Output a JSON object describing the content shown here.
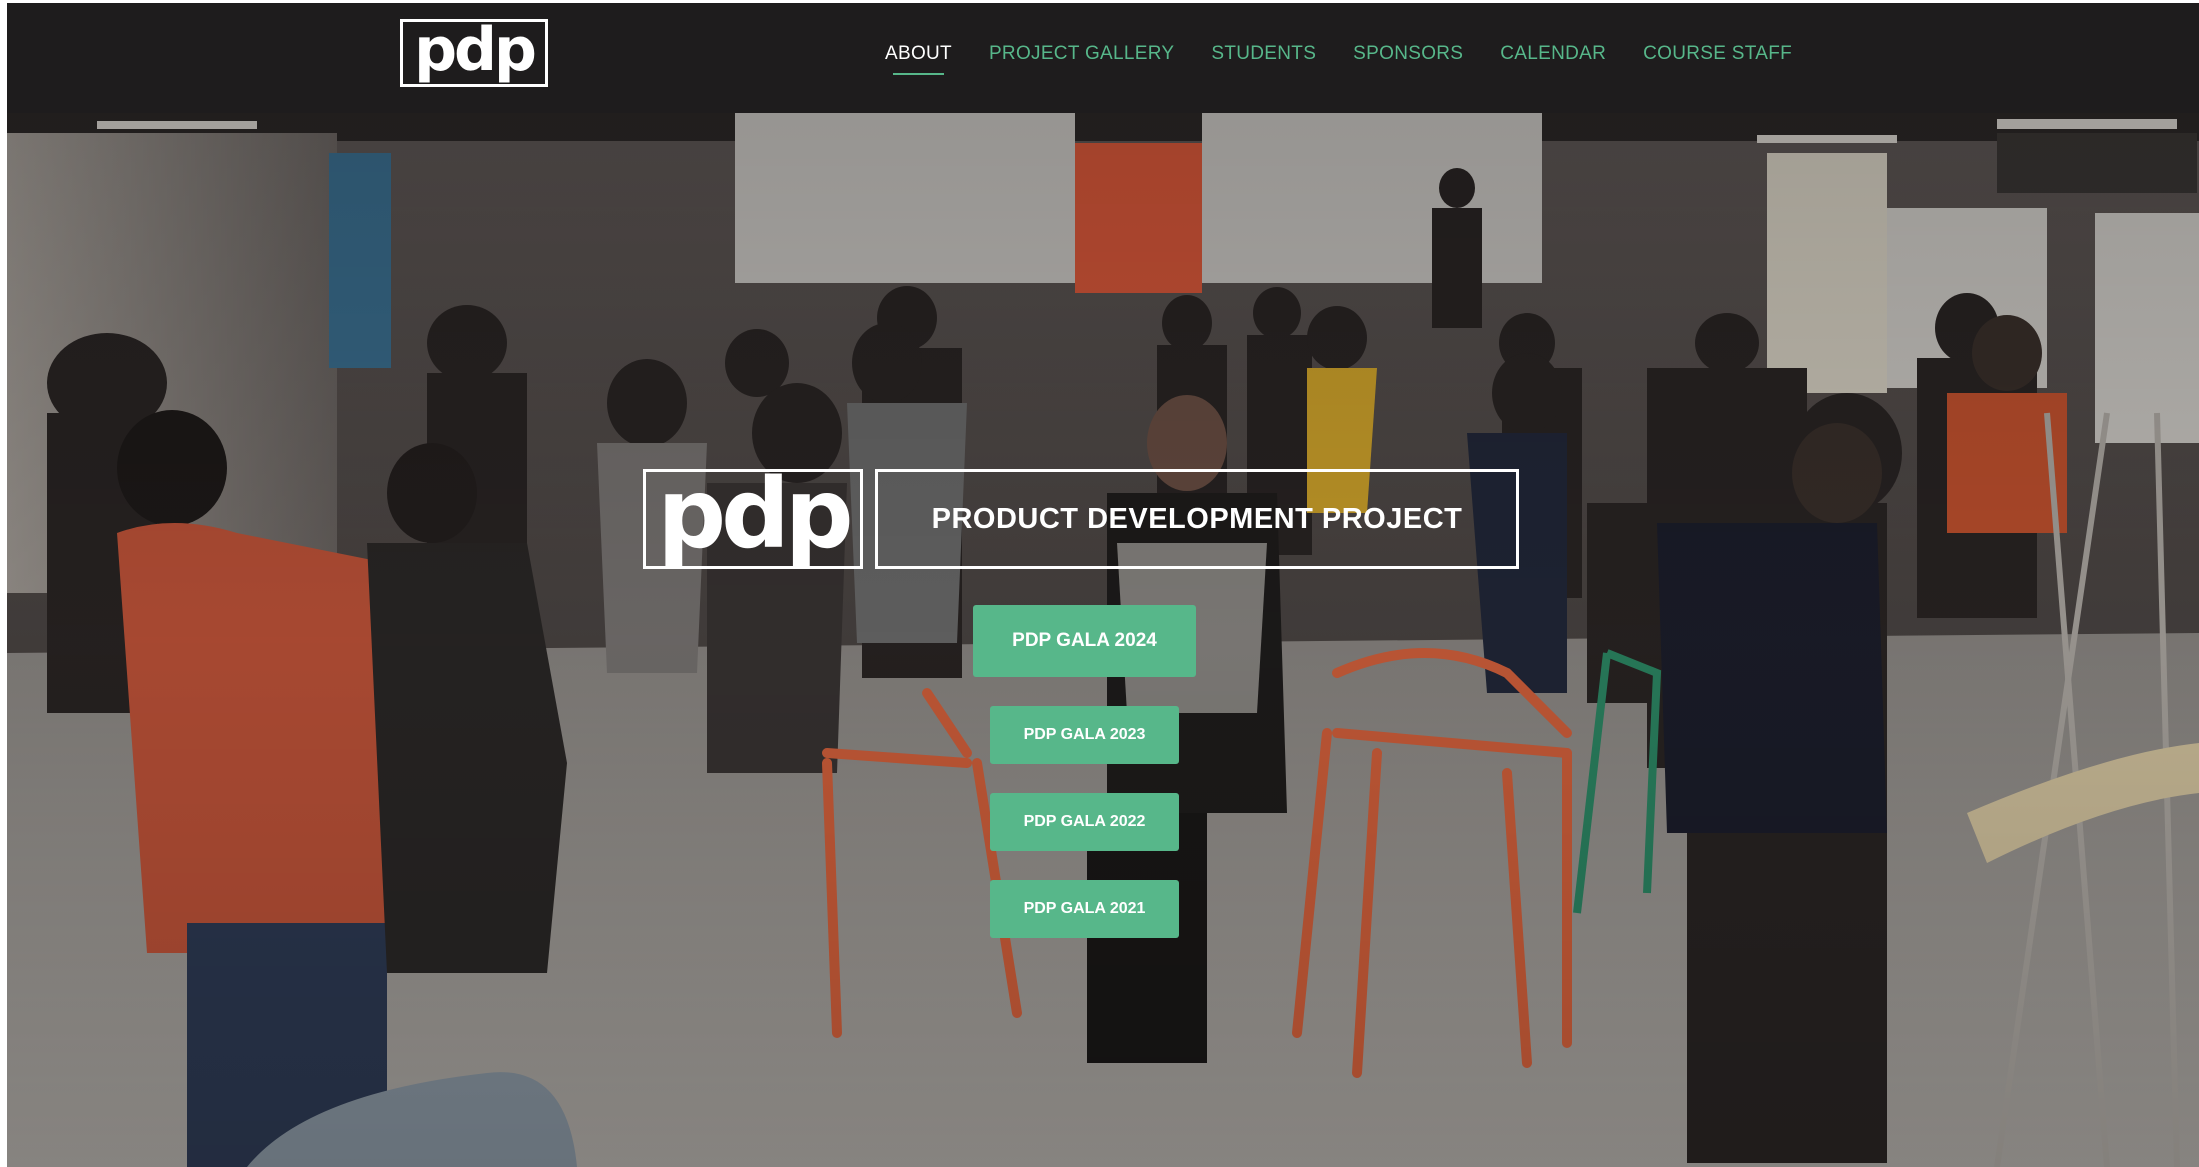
{
  "nav": {
    "logo_text": "pdp",
    "links": [
      {
        "label": "ABOUT",
        "active": true
      },
      {
        "label": "PROJECT GALLERY",
        "active": false
      },
      {
        "label": "STUDENTS",
        "active": false
      },
      {
        "label": "SPONSORS",
        "active": false
      },
      {
        "label": "CALENDAR",
        "active": false
      },
      {
        "label": "COURSE STAFF",
        "active": false
      }
    ]
  },
  "hero": {
    "logo_text": "pdp",
    "title": "PRODUCT DEVELOPMENT PROJECT",
    "buttons": [
      {
        "label": "PDP GALA 2024"
      },
      {
        "label": "PDP GALA 2023"
      },
      {
        "label": "PDP GALA 2022"
      },
      {
        "label": "PDP GALA 2021"
      }
    ]
  },
  "colors": {
    "accent_green": "#57b78a",
    "nav_background": "#1e1c1d",
    "text_white": "#ffffff"
  }
}
